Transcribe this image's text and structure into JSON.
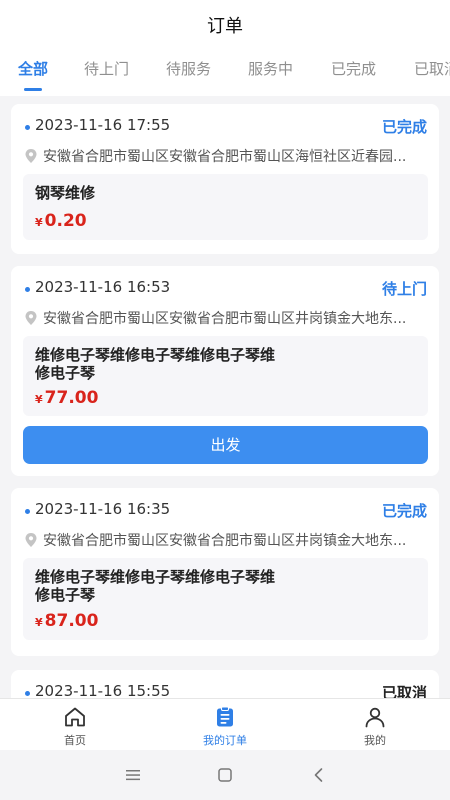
{
  "header": {
    "title": "订单"
  },
  "tabs": [
    {
      "label": "全部",
      "active": true
    },
    {
      "label": "待上门"
    },
    {
      "label": "待服务"
    },
    {
      "label": "服务中"
    },
    {
      "label": "已完成"
    },
    {
      "label": "已取消"
    }
  ],
  "orders": [
    {
      "time": "2023-11-16 17:55",
      "status": "已完成",
      "address": "安徽省合肥市蜀山区安徽省合肥市蜀山区海恒社区近春园...",
      "product": "钢琴维修",
      "currency": "¥",
      "price": "0.20"
    },
    {
      "time": "2023-11-16 16:53",
      "status": "待上门",
      "address": "安徽省合肥市蜀山区安徽省合肥市蜀山区井岗镇金大地东...",
      "product": "维修电子琴维修电子琴维修电子琴维修电子琴",
      "currency": "¥",
      "price": "77.00",
      "action": "出发"
    },
    {
      "time": "2023-11-16 16:35",
      "status": "已完成",
      "address": "安徽省合肥市蜀山区安徽省合肥市蜀山区井岗镇金大地东...",
      "product": "维修电子琴维修电子琴维修电子琴维修电子琴",
      "currency": "¥",
      "price": "87.00"
    },
    {
      "time": "2023-11-16 15:55",
      "status": "已取消"
    }
  ],
  "nav": [
    {
      "label": "首页",
      "icon": "home-icon"
    },
    {
      "label": "我的订单",
      "icon": "clipboard-icon",
      "active": true
    },
    {
      "label": "我的",
      "icon": "user-icon"
    }
  ],
  "colors": {
    "accent": "#2f7fe6",
    "price": "#d9241c",
    "button": "#3d8ef0"
  }
}
